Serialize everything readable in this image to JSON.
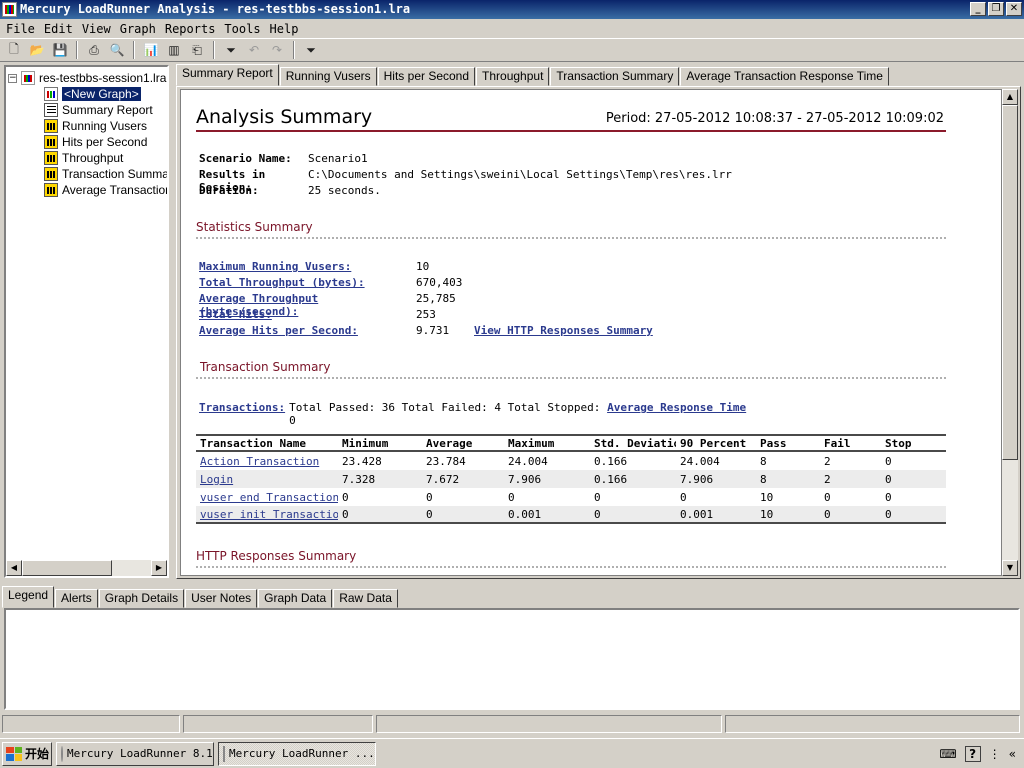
{
  "window": {
    "title": "Mercury LoadRunner Analysis - res-testbbs-session1.lra"
  },
  "menu": [
    "File",
    "Edit",
    "View",
    "Graph",
    "Reports",
    "Tools",
    "Help"
  ],
  "tree": {
    "root": "res-testbbs-session1.lra",
    "items": [
      "<New Graph>",
      "Summary Report",
      "Running Vusers",
      "Hits per Second",
      "Throughput",
      "Transaction Summary",
      "Average Transaction"
    ]
  },
  "tabs": [
    "Summary Report",
    "Running Vusers",
    "Hits per Second",
    "Throughput",
    "Transaction Summary",
    "Average Transaction Response Time"
  ],
  "report": {
    "title": "Analysis Summary",
    "period": "Period: 27-05-2012 10:08:37 - 27-05-2012 10:09:02",
    "info": [
      {
        "label": "Scenario Name:",
        "value": "Scenario1"
      },
      {
        "label": "Results in Session:",
        "value": "C:\\Documents and Settings\\sweini\\Local Settings\\Temp\\res\\res.lrr"
      },
      {
        "label": "Duration:",
        "value": "25 seconds."
      }
    ],
    "statistics_title": "Statistics Summary",
    "stats": [
      {
        "label": "Maximum Running Vusers:",
        "value": "10"
      },
      {
        "label": "Total Throughput (bytes):",
        "value": "670,403"
      },
      {
        "label": "Average Throughput (bytes/second):",
        "value": "25,785"
      },
      {
        "label": "Total Hits:",
        "value": "253"
      },
      {
        "label": "Average Hits per Second:",
        "value": "9.731"
      }
    ],
    "http_link": "View HTTP Responses Summary",
    "transaction_title": "Transaction Summary",
    "transactions_label": "Transactions:",
    "transactions_totals": "Total Passed: 36 Total Failed: 4 Total Stopped: 0",
    "avg_response_link": "Average Response Time",
    "table": {
      "headers": [
        "Transaction Name",
        "Minimum",
        "Average",
        "Maximum",
        "Std. Deviation",
        "90 Percent",
        "Pass",
        "Fail",
        "Stop"
      ],
      "rows": [
        [
          "Action Transaction",
          "23.428",
          "23.784",
          "24.004",
          "0.166",
          "24.004",
          "8",
          "2",
          "0"
        ],
        [
          "Login",
          "7.328",
          "7.672",
          "7.906",
          "0.166",
          "7.906",
          "8",
          "2",
          "0"
        ],
        [
          "vuser end Transaction",
          "0",
          "0",
          "0",
          "0",
          "0",
          "10",
          "0",
          "0"
        ],
        [
          "vuser init Transaction",
          "0",
          "0",
          "0.001",
          "0",
          "0.001",
          "10",
          "0",
          "0"
        ]
      ]
    },
    "http_title": "HTTP Responses Summary"
  },
  "bottom_tabs": [
    "Legend",
    "Alerts",
    "Graph Details",
    "User Notes",
    "Graph Data",
    "Raw Data"
  ],
  "taskbar": {
    "start": "开始",
    "tasks": [
      "Mercury LoadRunner 8.1",
      "Mercury LoadRunner ..."
    ]
  }
}
